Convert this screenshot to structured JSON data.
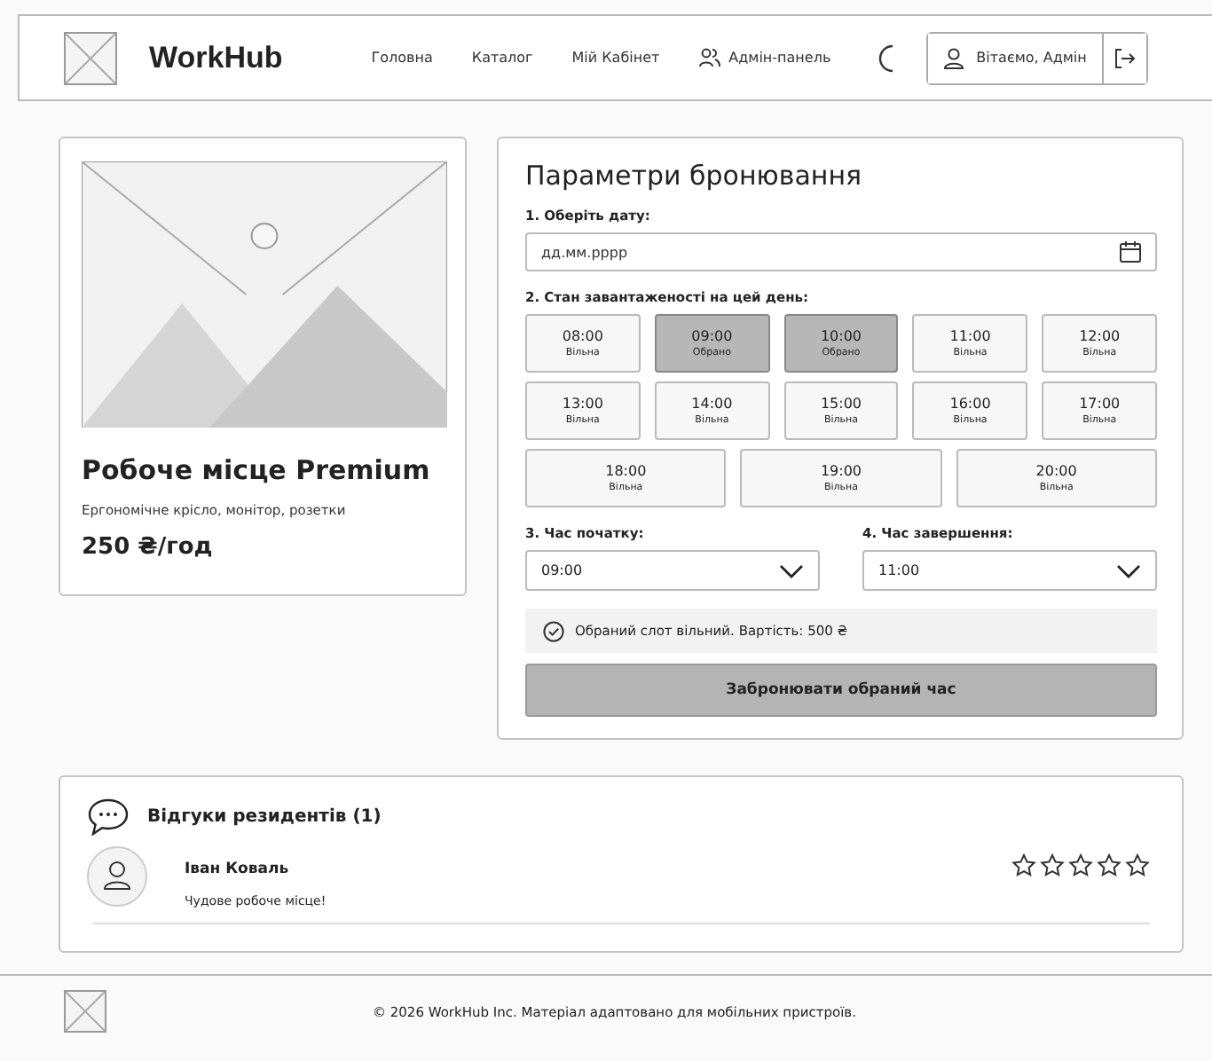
{
  "header": {
    "logo": "WorkHub",
    "nav": [
      {
        "label": "Головна",
        "icon": false
      },
      {
        "label": "Каталог",
        "icon": false
      },
      {
        "label": "Мій Кабінет",
        "icon": false
      },
      {
        "label": "Адмін-панель",
        "icon": true
      }
    ],
    "user": "Вітаємо, Адмін"
  },
  "workspace": {
    "title": "Робоче місце Premium",
    "description": "Ергономічне крісло, монітор, розетки",
    "price": "250 ₴/год"
  },
  "booking": {
    "title": "Параметри бронювання",
    "date_label": "1. Оберіть дату:",
    "date_placeholder": "дд.мм.рррр",
    "slots_label": "2. Стан завантаженості на цей день:",
    "slots": [
      {
        "time": "08:00",
        "status": "Вільна",
        "selected": false
      },
      {
        "time": "09:00",
        "status": "Обрано",
        "selected": true
      },
      {
        "time": "10:00",
        "status": "Обрано",
        "selected": true
      },
      {
        "time": "11:00",
        "status": "Вільна",
        "selected": false
      },
      {
        "time": "12:00",
        "status": "Вільна",
        "selected": false
      },
      {
        "time": "13:00",
        "status": "Вільна",
        "selected": false
      },
      {
        "time": "14:00",
        "status": "Вільна",
        "selected": false
      },
      {
        "time": "15:00",
        "status": "Вільна",
        "selected": false
      },
      {
        "time": "16:00",
        "status": "Вільна",
        "selected": false
      },
      {
        "time": "17:00",
        "status": "Вільна",
        "selected": false
      },
      {
        "time": "18:00",
        "status": "Вільна",
        "selected": false
      },
      {
        "time": "19:00",
        "status": "Вільна",
        "selected": false
      },
      {
        "time": "20:00",
        "status": "Вільна",
        "selected": false
      }
    ],
    "start_label": "3. Час початку:",
    "start_value": "09:00",
    "end_label": "4. Час завершення:",
    "end_value": "11:00",
    "notice": "Обраний слот вільний. Вартість: 500 ₴",
    "submit": "Забронювати обраний час"
  },
  "reviews": {
    "title": "Відгуки резидентів (1)",
    "items": [
      {
        "author": "Іван Коваль",
        "text": "Чудове робоче місце!",
        "stars": 0
      }
    ]
  },
  "footer": "© 2026 WorkHub Inc. Матеріал адаптовано для мобільних пристроїв."
}
